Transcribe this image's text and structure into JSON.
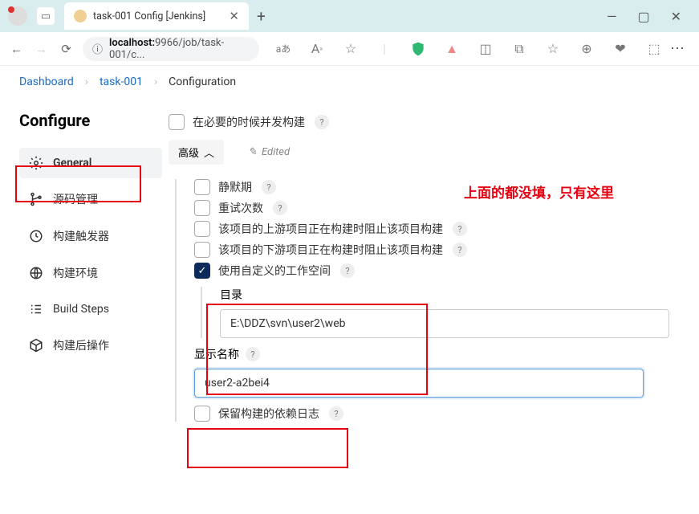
{
  "browser": {
    "tab_title": "task-001 Config [Jenkins]",
    "url_host": "localhost:",
    "url_port": "9966",
    "url_path": "/job/task-001/c...",
    "lang": "aあ"
  },
  "breadcrumbs": {
    "root": "Dashboard",
    "job": "task-001",
    "page": "Configuration"
  },
  "sidebar": {
    "title": "Configure",
    "items": [
      {
        "label": "General"
      },
      {
        "label": "源码管理"
      },
      {
        "label": "构建触发器"
      },
      {
        "label": "构建环境"
      },
      {
        "label": "Build Steps"
      },
      {
        "label": "构建后操作"
      }
    ]
  },
  "main": {
    "concurrent": "在必要的时候并发构建",
    "advanced": "高级",
    "edited": "Edited",
    "opts": {
      "quiet": "静默期",
      "retry": "重试次数",
      "upstream": "该项目的上游项目正在构建时阻止该项目构建",
      "downstream": "该项目的下游项目正在构建时阻止该项目构建",
      "custom_ws": "使用自定义的工作空间",
      "keep_log": "保留构建的依赖日志"
    },
    "dir_label": "目录",
    "dir_value": "E:\\DDZ\\svn\\user2\\web",
    "display_label": "显示名称",
    "display_value": "user2-a2bei4"
  },
  "annotation": "上面的都没填，只有这里"
}
